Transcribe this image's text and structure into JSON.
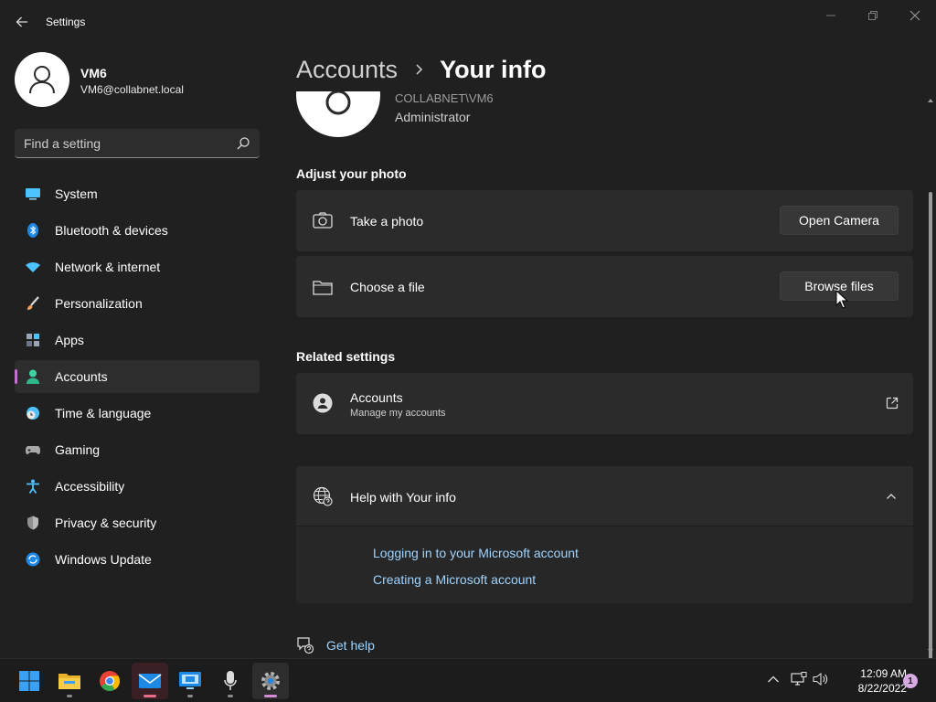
{
  "window": {
    "title": "Settings"
  },
  "profile": {
    "name": "VM6",
    "email": "VM6@collabnet.local"
  },
  "search": {
    "placeholder": "Find a setting"
  },
  "sidebar": {
    "items": [
      {
        "label": "System",
        "icon": "monitor-icon"
      },
      {
        "label": "Bluetooth & devices",
        "icon": "bluetooth-icon"
      },
      {
        "label": "Network & internet",
        "icon": "wifi-icon"
      },
      {
        "label": "Personalization",
        "icon": "brush-icon"
      },
      {
        "label": "Apps",
        "icon": "apps-icon"
      },
      {
        "label": "Accounts",
        "icon": "person-icon",
        "selected": true
      },
      {
        "label": "Time & language",
        "icon": "globe-clock-icon"
      },
      {
        "label": "Gaming",
        "icon": "gamepad-icon"
      },
      {
        "label": "Accessibility",
        "icon": "accessibility-icon"
      },
      {
        "label": "Privacy & security",
        "icon": "shield-icon"
      },
      {
        "label": "Windows Update",
        "icon": "update-icon"
      }
    ]
  },
  "breadcrumb": {
    "parent": "Accounts",
    "current": "Your info"
  },
  "account": {
    "domain_user": "COLLABNET\\VM6",
    "role": "Administrator"
  },
  "adjust_photo": {
    "heading": "Adjust your photo",
    "take_photo": {
      "label": "Take a photo",
      "button": "Open Camera",
      "icon": "camera-icon"
    },
    "choose_file": {
      "label": "Choose a file",
      "button": "Browse files",
      "icon": "folder-icon"
    }
  },
  "related": {
    "heading": "Related settings",
    "accounts": {
      "title": "Accounts",
      "subtitle": "Manage my accounts",
      "icon": "person-circle-icon",
      "action_icon": "open-external-icon"
    }
  },
  "help": {
    "title": "Help with Your info",
    "icon": "globe-help-icon",
    "expanded": true,
    "links": [
      "Logging in to your Microsoft account",
      "Creating a Microsoft account"
    ]
  },
  "get_help": {
    "label": "Get help",
    "icon": "chat-help-icon"
  },
  "taskbar": {
    "apps": [
      "start-icon",
      "file-explorer-icon",
      "chrome-icon",
      "mail-icon",
      "remote-desktop-icon",
      "microphone-icon",
      "settings-icon"
    ],
    "time": "12:09 AM",
    "date": "8/22/2022",
    "notification_count": "1"
  },
  "colors": {
    "accent": "#c56ed1",
    "link": "#9fd4ff",
    "background": "#202020",
    "card": "#2b2b2b"
  }
}
